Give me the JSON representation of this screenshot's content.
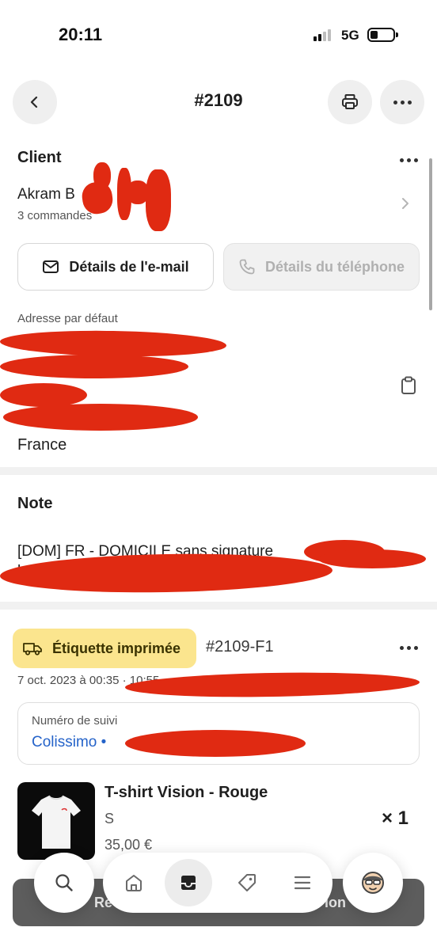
{
  "status_bar": {
    "time": "20:11",
    "network": "5G"
  },
  "header": {
    "order_number": "#2109",
    "back_icon": "chevron-left-icon",
    "print_icon": "printer-icon",
    "more_icon": "ellipsis-icon"
  },
  "customer": {
    "section_title": "Client",
    "name": "Akram B",
    "orders_count": "3 commandes",
    "email_button": "Détails de l'e-mail",
    "phone_button": "Détails du téléphone",
    "address_label": "Adresse par défaut",
    "country": "France"
  },
  "note": {
    "section_title": "Note",
    "text_line1": "[DOM] FR - DOMICILE sans signature",
    "text_line2": "l"
  },
  "fulfillment": {
    "badge_label": "Étiquette imprimée",
    "badge_icon": "truck-icon",
    "id": "#2109-F1",
    "date": "7 oct. 2023 à 00:35 · 10:55",
    "tracking_label": "Numéro de suivi",
    "tracking_carrier": "Colissimo •",
    "product": {
      "name": "T-shirt Vision - Rouge",
      "variant": "S",
      "price": "35,00 €",
      "quantity": "× 1"
    }
  },
  "bottom_action": {
    "left_fragment": "Re",
    "right_fragment": "ion"
  },
  "tabbar": {
    "items": [
      {
        "icon": "search-icon"
      },
      {
        "icon": "home-icon"
      },
      {
        "icon": "inbox-icon",
        "active": true
      },
      {
        "icon": "tag-icon"
      },
      {
        "icon": "menu-icon"
      },
      {
        "icon": "avatar-icon"
      }
    ]
  },
  "colors": {
    "accent_link": "#2563c9",
    "badge_bg": "#fbe58e",
    "redaction": "#e02a12"
  }
}
